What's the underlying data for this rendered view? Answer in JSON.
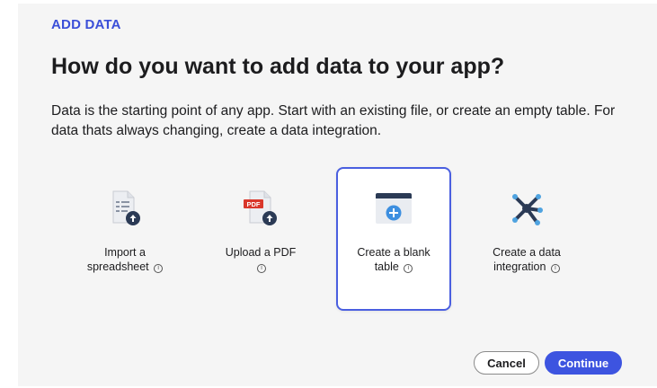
{
  "dialog": {
    "eyebrow": "ADD DATA",
    "title": "How do you want to add data to your app?",
    "description": "Data is the starting point of any app. Start with an existing file, or create an empty table. For data thats always changing, create a data integration."
  },
  "options": [
    {
      "label_line1": "Import a",
      "label_line2": "spreadsheet",
      "icon": "spreadsheet-upload-icon",
      "selected": false
    },
    {
      "label_line1": "Upload a PDF",
      "label_line2": "",
      "icon": "pdf-upload-icon",
      "selected": false
    },
    {
      "label_line1": "Create a blank",
      "label_line2": "table",
      "icon": "blank-table-add-icon",
      "selected": true
    },
    {
      "label_line1": "Create a data",
      "label_line2": "integration",
      "icon": "data-integration-network-icon",
      "selected": false
    }
  ],
  "info_glyph": "i",
  "buttons": {
    "cancel": "Cancel",
    "continue": "Continue"
  },
  "colors": {
    "accent": "#3d54e0",
    "selected_border": "#4a5fe0",
    "dialog_bg": "#f5f5f5",
    "pdf_badge": "#d9372b",
    "icon_navy": "#2b3a55",
    "integration_node": "#4fa3e0"
  }
}
